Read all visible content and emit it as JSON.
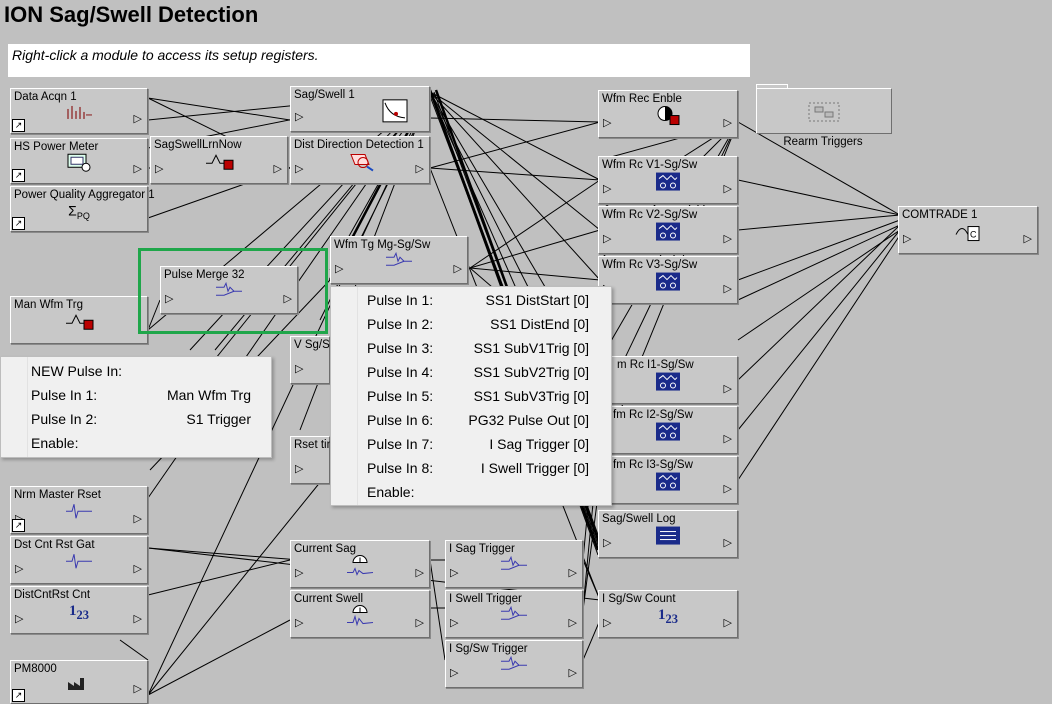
{
  "title": "ION Sag/Swell Detection",
  "hint": "Right-click a module to access its setup registers.",
  "modules": {
    "data_acqn": "Data Acqn 1",
    "hs_power_meter": "HS Power Meter",
    "pq_aggregator": "Power Quality Aggregator 1",
    "man_wfm_trg": "Man Wfm Trg",
    "nrm_master_rset": "Nrm Master Rset",
    "dst_cnt_rst_gat": "Dst Cnt Rst Gat",
    "dist_cnt_rst_cnt": "DistCntRst Cnt",
    "pm8000": "PM8000",
    "sag_swell_1": "Sag/Swell 1",
    "sagswell_lrn_now": "SagSwellLrnNow",
    "dist_direction": "Dist Direction Detection 1",
    "pulse_merge_32": "Pulse Merge 32",
    "wfm_tg_mg": "Wfm Tg Mg-Sg/Sw",
    "v_sg": "V Sg/S",
    "rset_tin": "Rset tin",
    "current_sag": "Current Sag",
    "current_swell": "Current Swell",
    "i_sag_trigger": "I Sag Trigger",
    "i_swell_trigger": "I Swell Trigger",
    "i_sgsw_trigger": "I Sg/Sw Trigger",
    "wfm_rec_enble": "Wfm Rec Enble",
    "wfm_rc_v1": "Wfm Rc V1-Sg/Sw",
    "wfm_rc_v2": "Wfm Rc V2-Sg/Sw",
    "wfm_rc_v3": "Wfm Rc V3-Sg/Sw",
    "wfm_rc_i1": "m Rc I1-Sg/Sw",
    "wfm_rc_i2": "fm Rc I2-Sg/Sw",
    "wfm_rc_i3": "fm Rc I3-Sg/Sw",
    "sag_swell_log": "Sag/Swell Log",
    "i_sgsw_count": "I Sg/Sw Count",
    "comtrade": "COMTRADE 1",
    "rearm_triggers": "Rearm Triggers"
  },
  "popup_left": {
    "rows": [
      {
        "label": "NEW  Pulse In:",
        "value": ""
      },
      {
        "label": "Pulse In 1:",
        "value": "Man Wfm Trg"
      },
      {
        "label": "Pulse In 2:",
        "value": "S1 Trigger"
      },
      {
        "label": "Enable:",
        "value": ""
      }
    ]
  },
  "popup_right": {
    "rows": [
      {
        "label": "Pulse In 1:",
        "value": "SS1 DistStart [0]"
      },
      {
        "label": "Pulse In 2:",
        "value": "SS1 DistEnd [0]"
      },
      {
        "label": "Pulse In 3:",
        "value": "SS1 SubV1Trig [0]"
      },
      {
        "label": "Pulse In 4:",
        "value": "SS1 SubV2Trig [0]"
      },
      {
        "label": "Pulse In 5:",
        "value": "SS1 SubV3Trig [0]"
      },
      {
        "label": "Pulse In 6:",
        "value": "PG32 Pulse Out [0]"
      },
      {
        "label": "Pulse In 7:",
        "value": "I Sag Trigger [0]"
      },
      {
        "label": "Pulse In 8:",
        "value": "I Swell Trigger [0]"
      },
      {
        "label": "Enable:",
        "value": ""
      }
    ]
  },
  "colors": {
    "canvas": "#c0c0c0",
    "highlight": "#1fa64a",
    "module": "#c8c8c8"
  }
}
